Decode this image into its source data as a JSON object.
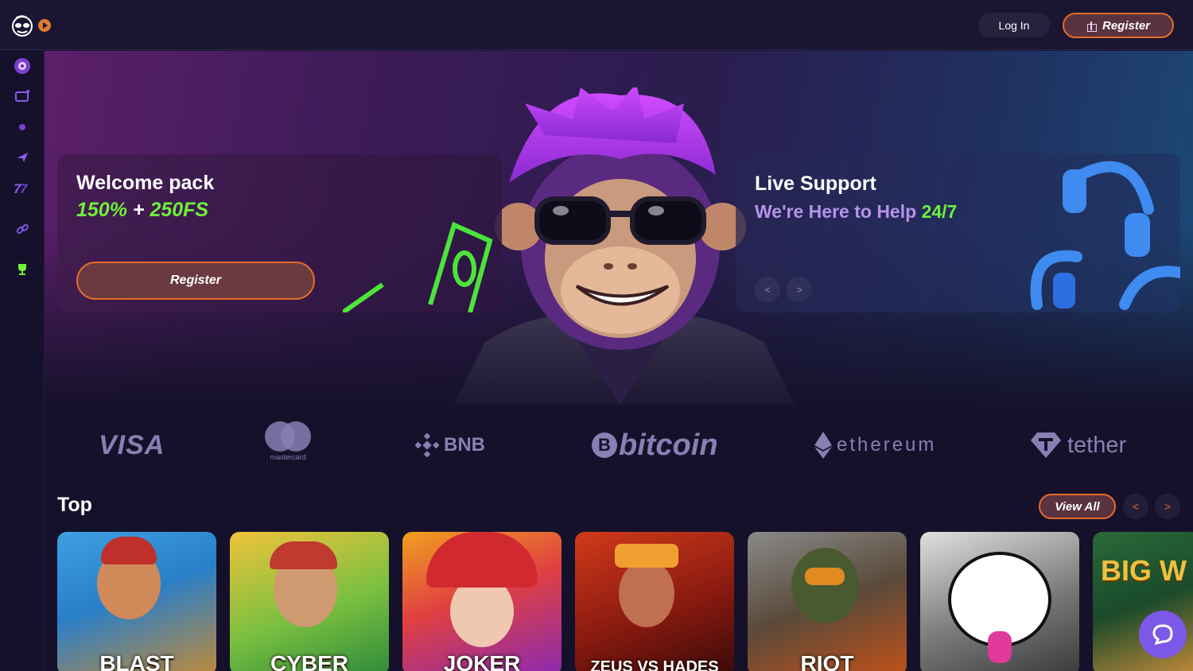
{
  "header": {
    "login_label": "Log In",
    "register_label": "Register",
    "icons": [
      "monkey-logo-icon",
      "play-icon",
      "gift-icon"
    ]
  },
  "sidebar": {
    "items": [
      {
        "icon": "roulette-icon"
      },
      {
        "icon": "tv-icon"
      },
      {
        "icon": "dot-icon"
      },
      {
        "icon": "plane-icon"
      },
      {
        "icon": "slot-777-icon"
      },
      {
        "icon": "link-icon"
      },
      {
        "icon": "trophy-icon"
      }
    ]
  },
  "hero": {
    "welcome": {
      "title": "Welcome pack",
      "bonus_percent": "150%",
      "bonus_plus": " + ",
      "bonus_fs": "250FS",
      "button_label": "Register"
    },
    "support": {
      "title": "Live Support",
      "subtitle": "We're Here to Help",
      "subtitle_highlight": "24/7",
      "prev_label": "<",
      "next_label": ">"
    }
  },
  "payments": {
    "visa": "VISA",
    "mastercard": "mastercard",
    "bnb": "BNB",
    "bitcoin": "bitcoin",
    "bitcoin_symbol": "B",
    "ethereum": "ethereum",
    "tether": "tether"
  },
  "top_section": {
    "title": "Top",
    "view_all_label": "View All",
    "prev_label": "<",
    "next_label": ">",
    "games": [
      {
        "title": "BLAST"
      },
      {
        "title": "CYBER"
      },
      {
        "title": "JOKER"
      },
      {
        "title": "ZEUS VS HADES"
      },
      {
        "title": "RIOT"
      },
      {
        "title": ""
      },
      {
        "title": "BIG W"
      }
    ]
  },
  "colors": {
    "accent": "#e46b2b",
    "green": "#6ff03a",
    "background": "#15112a",
    "chat": "#7b59e6"
  }
}
